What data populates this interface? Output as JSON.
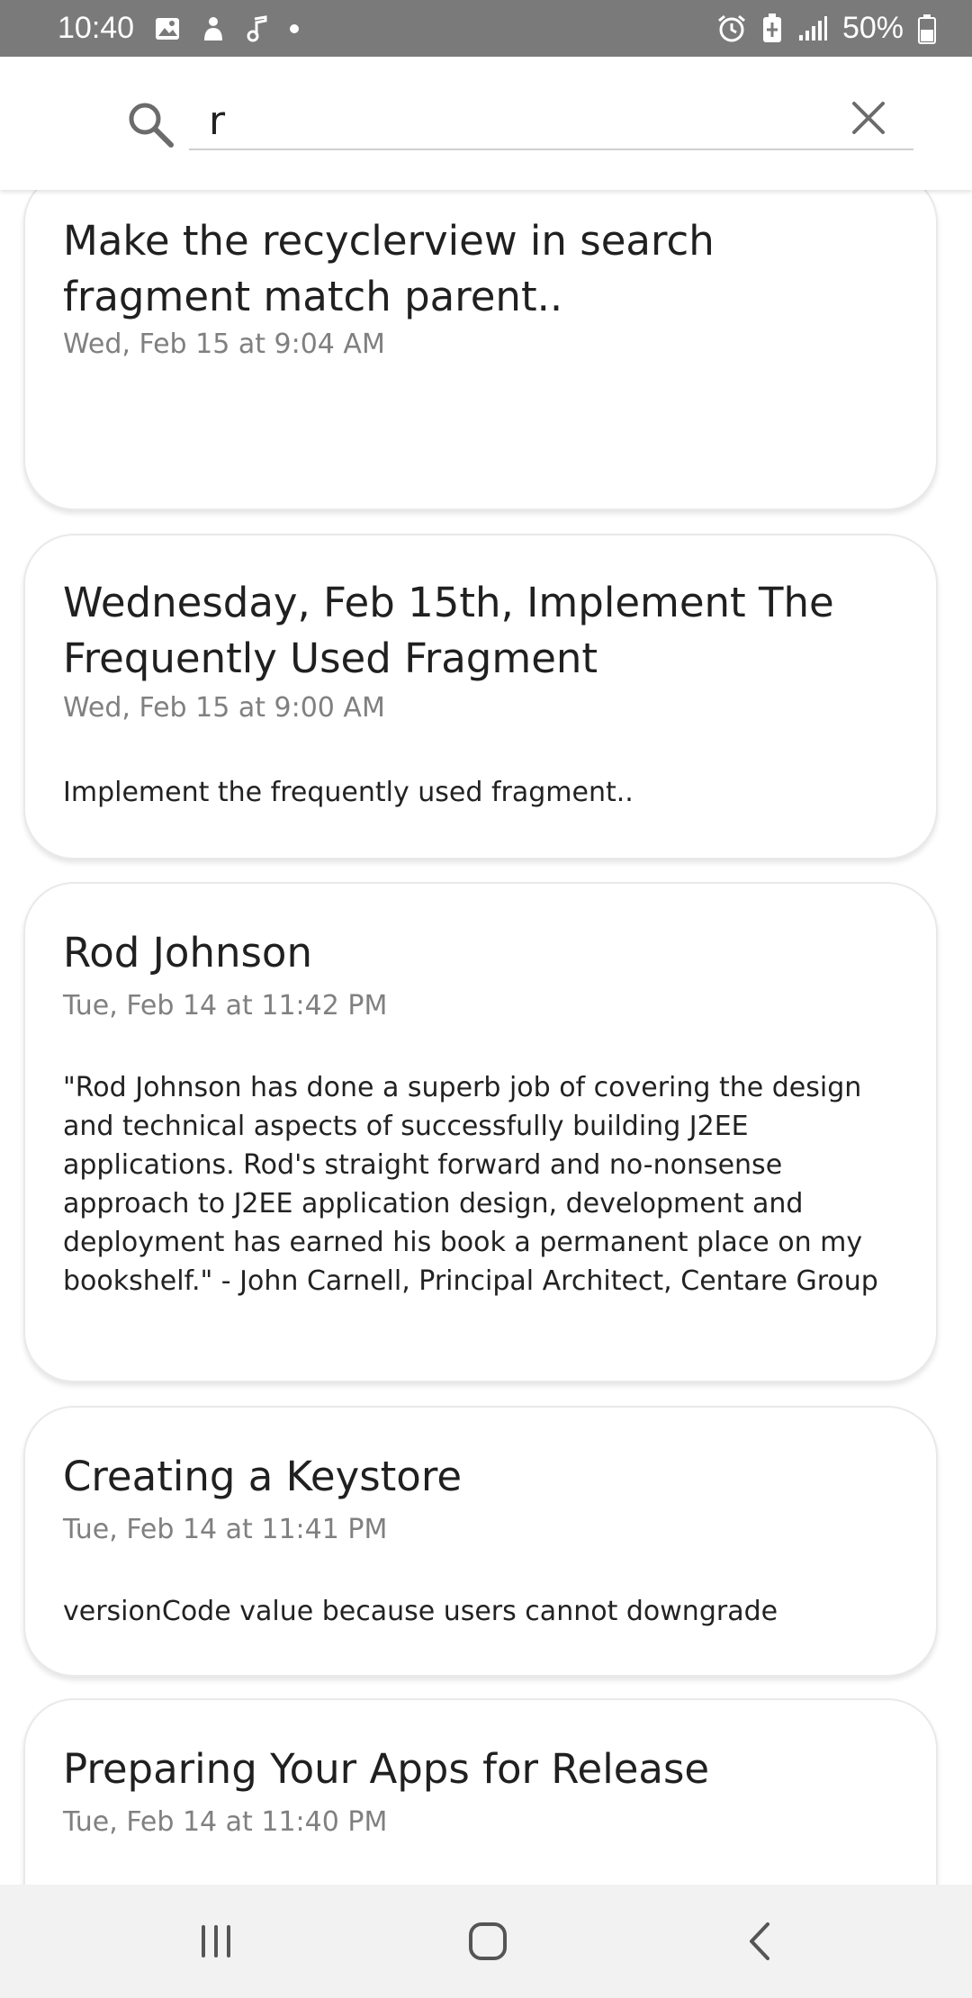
{
  "status_bar": {
    "time": "10:40",
    "battery": "50%",
    "left_icons": [
      "image-icon",
      "person-icon",
      "music-note-icon",
      "dot-icon"
    ],
    "right_icons": [
      "alarm-icon",
      "battery-saver-icon",
      "signal-icon",
      "battery-icon"
    ]
  },
  "search": {
    "value": "r"
  },
  "notes": [
    {
      "title": "Make the recyclerview in search fragment match parent..",
      "date": "Wed, Feb 15 at 9:04 AM",
      "body": ""
    },
    {
      "title": "Wednesday, Feb 15th, Implement The Frequently Used Fragment",
      "date": "Wed, Feb 15 at 9:00 AM",
      "body": "Implement the frequently used fragment.."
    },
    {
      "title": "Rod Johnson",
      "date": "Tue, Feb 14 at 11:42 PM",
      "body": "\"Rod Johnson has done a superb job of covering the design and technical aspects of successfully building J2EE applications. Rod's straight forward and no-nonsense approach to J2EE application design, development and deployment has earned his book a permanent place on my bookshelf.\" - John Carnell, Principal Architect, Centare Group"
    },
    {
      "title": "Creating a Keystore",
      "date": "Tue, Feb 14 at 11:41 PM",
      "body": "versionCode value because users cannot downgrade"
    },
    {
      "title": "Preparing Your Apps for Release",
      "date": "Tue, Feb 14 at 11:40 PM",
      "body": ""
    }
  ],
  "nav": {
    "icons": [
      "recent-apps-icon",
      "home-icon",
      "back-icon"
    ]
  },
  "colors": {
    "status_bar": "#7a7a7a",
    "nav_bar": "#f2f2f2",
    "card_border": "#e9e9e9",
    "date_text": "#808080"
  }
}
